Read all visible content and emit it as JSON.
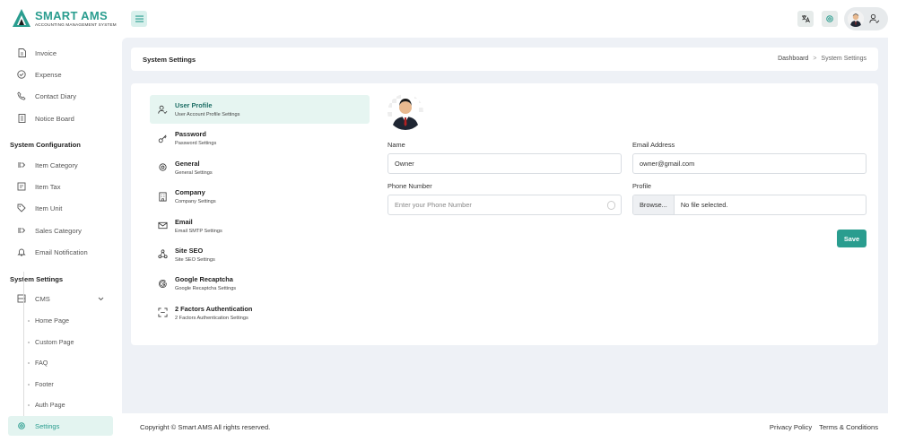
{
  "brand": {
    "title": "SMART AMS",
    "subtitle": "ACCOUNTING MANAGEMENT SYSTEM",
    "accent": "#2a9d8f"
  },
  "header": {
    "menu_icon": "hamburger-icon",
    "translate_icon": "translate-icon",
    "settings_icon": "gear-icon",
    "user_icon": "user-check-icon"
  },
  "sidebar": {
    "items_top": [
      {
        "label": "Invoice",
        "icon": "file-icon"
      },
      {
        "label": "Expense",
        "icon": "check-circle-icon"
      },
      {
        "label": "Contact Diary",
        "icon": "phone-icon"
      },
      {
        "label": "Notice Board",
        "icon": "notebook-icon"
      }
    ],
    "section_config": "System Configuration",
    "items_config": [
      {
        "label": "Item Category",
        "icon": "category-icon"
      },
      {
        "label": "Item Tax",
        "icon": "tax-icon"
      },
      {
        "label": "Item Unit",
        "icon": "tag-icon"
      },
      {
        "label": "Sales Category",
        "icon": "category-icon"
      },
      {
        "label": "Email Notification",
        "icon": "bell-icon"
      }
    ],
    "section_settings": "System Settings",
    "cms": {
      "label": "CMS",
      "icon": "layout-icon"
    },
    "cms_children": [
      "Home Page",
      "Custom Page",
      "FAQ",
      "Footer",
      "Auth Page"
    ],
    "settings": {
      "label": "Settings",
      "icon": "gear-icon"
    }
  },
  "page": {
    "title": "System Settings",
    "breadcrumb": {
      "root": "Dashboard",
      "sep": ">",
      "current": "System Settings"
    }
  },
  "settings_menu": [
    {
      "title": "User Profile",
      "sub": "User Account Profile Settings",
      "icon": "user-check-icon"
    },
    {
      "title": "Password",
      "sub": "Password Settings",
      "icon": "key-icon"
    },
    {
      "title": "General",
      "sub": "General Settings",
      "icon": "gear-icon"
    },
    {
      "title": "Company",
      "sub": "Company Settings",
      "icon": "building-icon"
    },
    {
      "title": "Email",
      "sub": "Email SMTP Settings",
      "icon": "mail-icon"
    },
    {
      "title": "Site SEO",
      "sub": "Site SEO Settings",
      "icon": "network-icon"
    },
    {
      "title": "Google Recaptcha",
      "sub": "Google Recaptcha Settings",
      "icon": "google-icon"
    },
    {
      "title": "2 Factors Authentication",
      "sub": "2 Factors Authentication Settings",
      "icon": "scan-icon"
    }
  ],
  "form": {
    "name_label": "Name",
    "name_value": "Owner",
    "email_label": "Email Address",
    "email_value": "owner@gmail.com",
    "phone_label": "Phone Number",
    "phone_placeholder": "Enter your Phone Number",
    "profile_label": "Profile",
    "browse_label": "Browse...",
    "file_status": "No file selected.",
    "save_label": "Save"
  },
  "footer": {
    "copyright": "Copyright © Smart AMS All rights reserved.",
    "privacy": "Privacy Policy",
    "terms": "Terms & Conditions"
  }
}
